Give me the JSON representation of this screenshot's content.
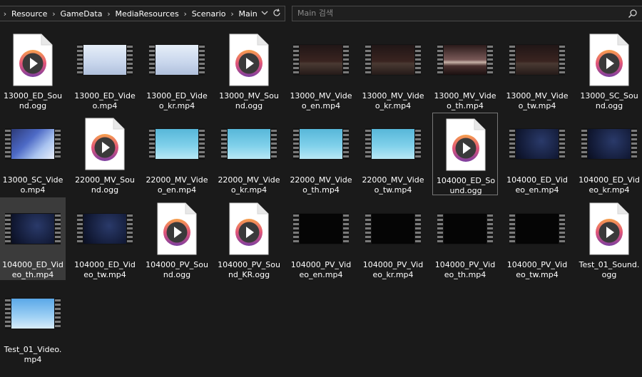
{
  "address_bar": {
    "crumbs": [
      "Resource",
      "GameData",
      "MediaResources",
      "Scenario",
      "Main"
    ]
  },
  "search": {
    "placeholder": "Main 검색"
  },
  "files": [
    {
      "name": "13000_ED_Sound.ogg",
      "kind": "audio"
    },
    {
      "name": "13000_ED_Video.mp4",
      "kind": "video",
      "thumb": "pale"
    },
    {
      "name": "13000_ED_Video_kr.mp4",
      "kind": "video",
      "thumb": "pale"
    },
    {
      "name": "13000_MV_Sound.ogg",
      "kind": "audio"
    },
    {
      "name": "13000_MV_Video_en.mp4",
      "kind": "video",
      "thumb": "brown"
    },
    {
      "name": "13000_MV_Video_kr.mp4",
      "kind": "video",
      "thumb": "brown"
    },
    {
      "name": "13000_MV_Video_th.mp4",
      "kind": "video",
      "thumb": "brown2"
    },
    {
      "name": "13000_MV_Video_tw.mp4",
      "kind": "video",
      "thumb": "brown"
    },
    {
      "name": "13000_SC_Sound.ogg",
      "kind": "audio"
    },
    {
      "name": "13000_SC_Video.mp4",
      "kind": "video",
      "thumb": "anime"
    },
    {
      "name": "22000_MV_Sound.ogg",
      "kind": "audio"
    },
    {
      "name": "22000_MV_Video_en.mp4",
      "kind": "video",
      "thumb": "sky"
    },
    {
      "name": "22000_MV_Video_kr.mp4",
      "kind": "video",
      "thumb": "sky"
    },
    {
      "name": "22000_MV_Video_th.mp4",
      "kind": "video",
      "thumb": "sky"
    },
    {
      "name": "22000_MV_Video_tw.mp4",
      "kind": "video",
      "thumb": "sky"
    },
    {
      "name": "104000_ED_Sound.ogg",
      "kind": "audio",
      "state": "selected"
    },
    {
      "name": "104000_ED_Video_en.mp4",
      "kind": "video",
      "thumb": "navy"
    },
    {
      "name": "104000_ED_Video_kr.mp4",
      "kind": "video",
      "thumb": "navy"
    },
    {
      "name": "104000_ED_Video_th.mp4",
      "kind": "video",
      "thumb": "navy",
      "state": "hover"
    },
    {
      "name": "104000_ED_Video_tw.mp4",
      "kind": "video",
      "thumb": "navy"
    },
    {
      "name": "104000_PV_Sound.ogg",
      "kind": "audio"
    },
    {
      "name": "104000_PV_Sound_KR.ogg",
      "kind": "audio"
    },
    {
      "name": "104000_PV_Video_en.mp4",
      "kind": "video",
      "thumb": "black"
    },
    {
      "name": "104000_PV_Video_kr.mp4",
      "kind": "video",
      "thumb": "black"
    },
    {
      "name": "104000_PV_Video_th.mp4",
      "kind": "video",
      "thumb": "black"
    },
    {
      "name": "104000_PV_Video_tw.mp4",
      "kind": "video",
      "thumb": "black"
    },
    {
      "name": "Test_01_Sound.ogg",
      "kind": "audio"
    },
    {
      "name": "Test_01_Video.mp4",
      "kind": "video",
      "thumb": "tower"
    }
  ],
  "colors": {
    "background": "#1a1a1a",
    "play_ring_top": "#f6a04d",
    "play_ring_bottom": "#7b3fa0",
    "selection_border": "#777777",
    "hover_fill": "#3b3b3b"
  }
}
